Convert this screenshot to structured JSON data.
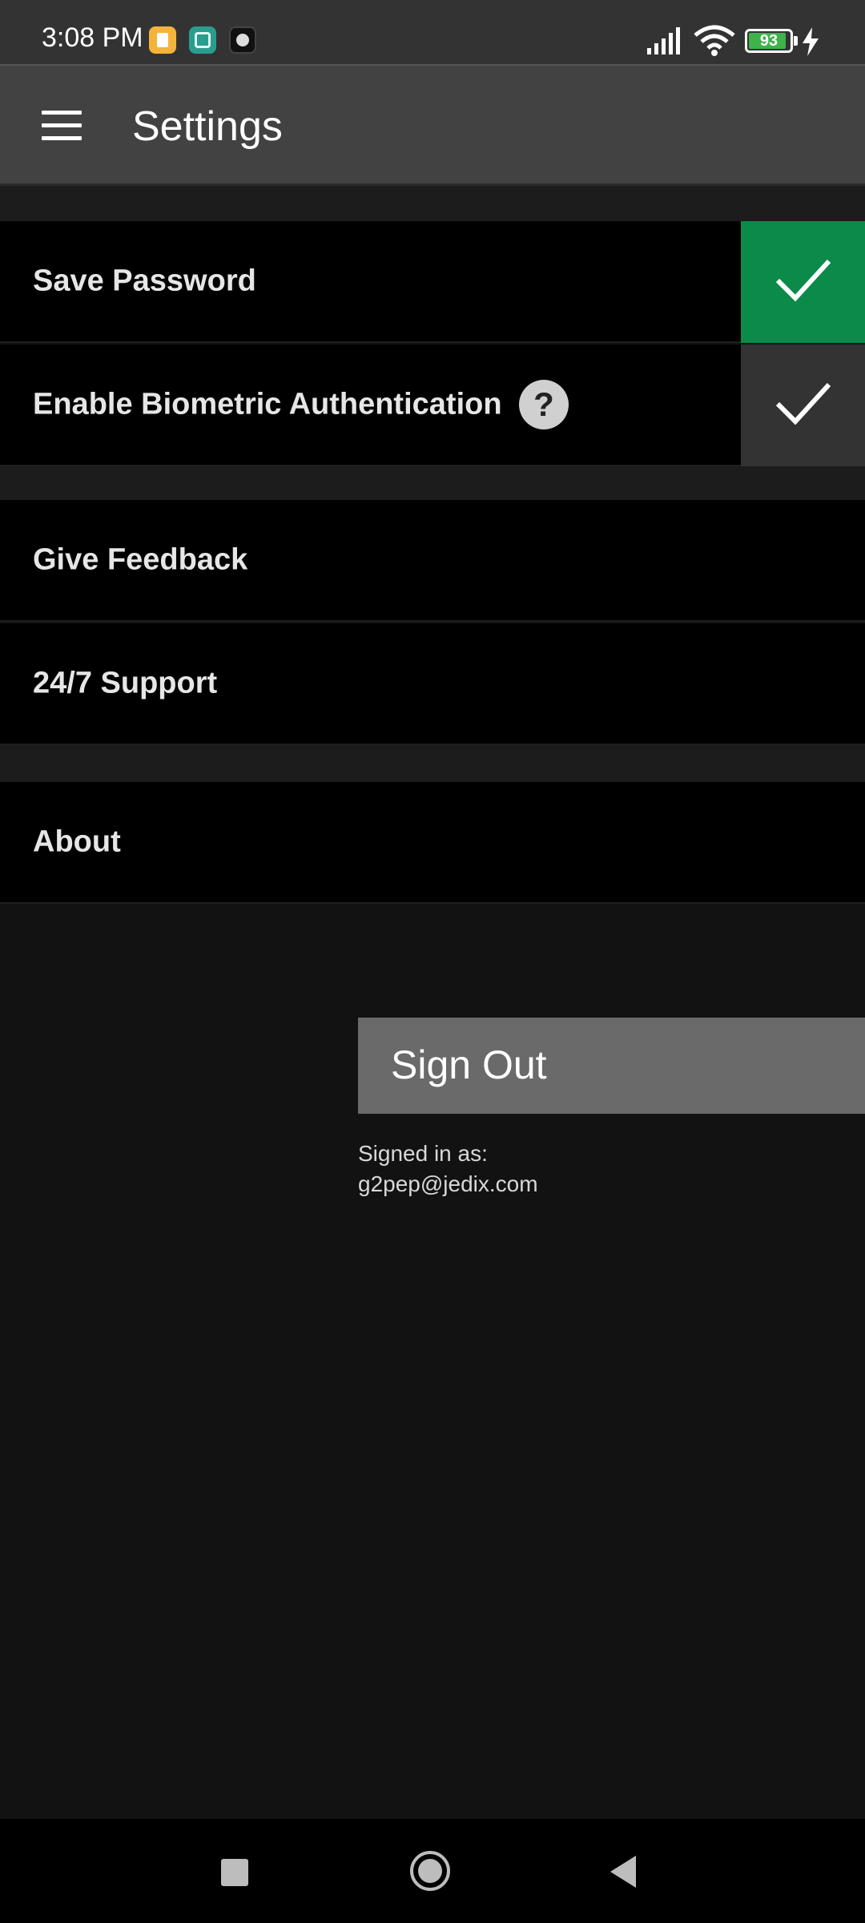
{
  "status_bar": {
    "time": "3:08 PM",
    "battery_level": "93",
    "battery_fraction": 0.93,
    "icons": [
      "notes-app-icon",
      "mirror-app-icon",
      "camera-app-icon",
      "signal-icon",
      "wifi-icon",
      "battery-icon",
      "charging-bolt-icon"
    ]
  },
  "app_bar": {
    "title": "Settings",
    "menu_icon": "hamburger-menu-icon"
  },
  "settings": {
    "save_password": {
      "label": "Save Password",
      "checked": true,
      "accent": "#0b8a4a"
    },
    "biometric": {
      "label": "Enable Biometric Authentication",
      "checked": false,
      "help": "?"
    },
    "give_feedback": {
      "label": "Give Feedback"
    },
    "support": {
      "label": "24/7 Support"
    },
    "about": {
      "label": "About"
    }
  },
  "account": {
    "sign_out_label": "Sign Out",
    "signed_in_caption": "Signed in as:",
    "email": "g2pep@jedix.com"
  },
  "nav_bar": {
    "buttons": [
      "recents-icon",
      "home-icon",
      "back-icon"
    ]
  },
  "colors": {
    "checked_accent": "#0b8a4a",
    "unchecked_box": "#333333",
    "app_bar": "#424242",
    "background": "#121212"
  }
}
